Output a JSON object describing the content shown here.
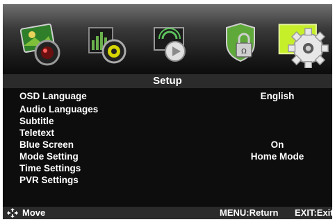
{
  "icons": [
    {
      "name": "picture-icon",
      "selected": false
    },
    {
      "name": "audio-icon",
      "selected": false
    },
    {
      "name": "channel-icon",
      "selected": false
    },
    {
      "name": "lock-icon",
      "selected": false
    },
    {
      "name": "setup-gear-icon",
      "selected": true
    }
  ],
  "title": "Setup",
  "menu": {
    "items": [
      {
        "label": "OSD Language",
        "value": "English"
      },
      {
        "label": "Audio Languages",
        "value": ""
      },
      {
        "label": "Subtitle",
        "value": ""
      },
      {
        "label": "Teletext",
        "value": ""
      },
      {
        "label": "Blue Screen",
        "value": "On"
      },
      {
        "label": "Mode Setting",
        "value": "Home Mode"
      },
      {
        "label": "Time Settings",
        "value": ""
      },
      {
        "label": "PVR Settings",
        "value": ""
      }
    ]
  },
  "footer": {
    "move": "Move",
    "menu_return": "MENU:Return",
    "exit": "EXIT:Exit"
  },
  "colors": {
    "selected_tile": "#c6ef2a",
    "title_bg": "#2b2b2b",
    "screen_bg": "#0d0d0d"
  }
}
